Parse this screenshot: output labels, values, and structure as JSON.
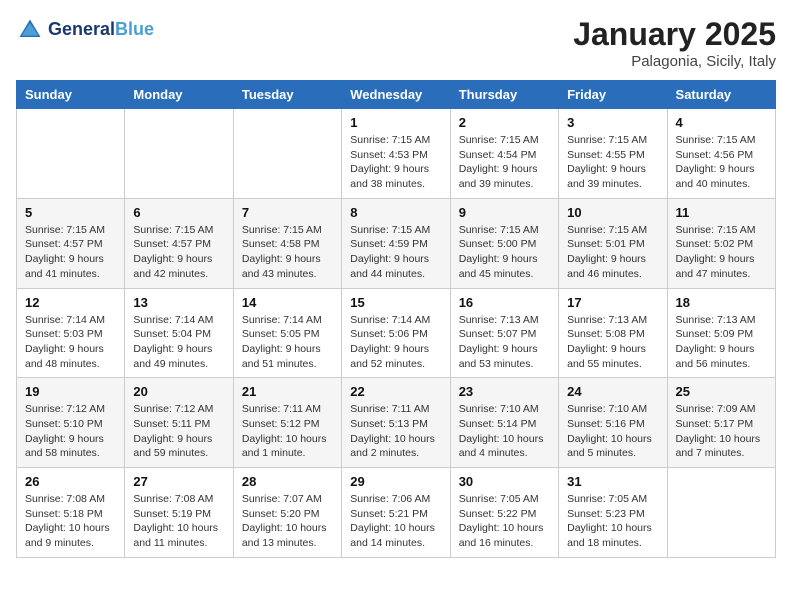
{
  "header": {
    "logo_line1": "General",
    "logo_line2": "Blue",
    "main_title": "January 2025",
    "subtitle": "Palagonia, Sicily, Italy"
  },
  "weekdays": [
    "Sunday",
    "Monday",
    "Tuesday",
    "Wednesday",
    "Thursday",
    "Friday",
    "Saturday"
  ],
  "weeks": [
    [
      {
        "day": "",
        "info": ""
      },
      {
        "day": "",
        "info": ""
      },
      {
        "day": "",
        "info": ""
      },
      {
        "day": "1",
        "info": "Sunrise: 7:15 AM\nSunset: 4:53 PM\nDaylight: 9 hours\nand 38 minutes."
      },
      {
        "day": "2",
        "info": "Sunrise: 7:15 AM\nSunset: 4:54 PM\nDaylight: 9 hours\nand 39 minutes."
      },
      {
        "day": "3",
        "info": "Sunrise: 7:15 AM\nSunset: 4:55 PM\nDaylight: 9 hours\nand 39 minutes."
      },
      {
        "day": "4",
        "info": "Sunrise: 7:15 AM\nSunset: 4:56 PM\nDaylight: 9 hours\nand 40 minutes."
      }
    ],
    [
      {
        "day": "5",
        "info": "Sunrise: 7:15 AM\nSunset: 4:57 PM\nDaylight: 9 hours\nand 41 minutes."
      },
      {
        "day": "6",
        "info": "Sunrise: 7:15 AM\nSunset: 4:57 PM\nDaylight: 9 hours\nand 42 minutes."
      },
      {
        "day": "7",
        "info": "Sunrise: 7:15 AM\nSunset: 4:58 PM\nDaylight: 9 hours\nand 43 minutes."
      },
      {
        "day": "8",
        "info": "Sunrise: 7:15 AM\nSunset: 4:59 PM\nDaylight: 9 hours\nand 44 minutes."
      },
      {
        "day": "9",
        "info": "Sunrise: 7:15 AM\nSunset: 5:00 PM\nDaylight: 9 hours\nand 45 minutes."
      },
      {
        "day": "10",
        "info": "Sunrise: 7:15 AM\nSunset: 5:01 PM\nDaylight: 9 hours\nand 46 minutes."
      },
      {
        "day": "11",
        "info": "Sunrise: 7:15 AM\nSunset: 5:02 PM\nDaylight: 9 hours\nand 47 minutes."
      }
    ],
    [
      {
        "day": "12",
        "info": "Sunrise: 7:14 AM\nSunset: 5:03 PM\nDaylight: 9 hours\nand 48 minutes."
      },
      {
        "day": "13",
        "info": "Sunrise: 7:14 AM\nSunset: 5:04 PM\nDaylight: 9 hours\nand 49 minutes."
      },
      {
        "day": "14",
        "info": "Sunrise: 7:14 AM\nSunset: 5:05 PM\nDaylight: 9 hours\nand 51 minutes."
      },
      {
        "day": "15",
        "info": "Sunrise: 7:14 AM\nSunset: 5:06 PM\nDaylight: 9 hours\nand 52 minutes."
      },
      {
        "day": "16",
        "info": "Sunrise: 7:13 AM\nSunset: 5:07 PM\nDaylight: 9 hours\nand 53 minutes."
      },
      {
        "day": "17",
        "info": "Sunrise: 7:13 AM\nSunset: 5:08 PM\nDaylight: 9 hours\nand 55 minutes."
      },
      {
        "day": "18",
        "info": "Sunrise: 7:13 AM\nSunset: 5:09 PM\nDaylight: 9 hours\nand 56 minutes."
      }
    ],
    [
      {
        "day": "19",
        "info": "Sunrise: 7:12 AM\nSunset: 5:10 PM\nDaylight: 9 hours\nand 58 minutes."
      },
      {
        "day": "20",
        "info": "Sunrise: 7:12 AM\nSunset: 5:11 PM\nDaylight: 9 hours\nand 59 minutes."
      },
      {
        "day": "21",
        "info": "Sunrise: 7:11 AM\nSunset: 5:12 PM\nDaylight: 10 hours\nand 1 minute."
      },
      {
        "day": "22",
        "info": "Sunrise: 7:11 AM\nSunset: 5:13 PM\nDaylight: 10 hours\nand 2 minutes."
      },
      {
        "day": "23",
        "info": "Sunrise: 7:10 AM\nSunset: 5:14 PM\nDaylight: 10 hours\nand 4 minutes."
      },
      {
        "day": "24",
        "info": "Sunrise: 7:10 AM\nSunset: 5:16 PM\nDaylight: 10 hours\nand 5 minutes."
      },
      {
        "day": "25",
        "info": "Sunrise: 7:09 AM\nSunset: 5:17 PM\nDaylight: 10 hours\nand 7 minutes."
      }
    ],
    [
      {
        "day": "26",
        "info": "Sunrise: 7:08 AM\nSunset: 5:18 PM\nDaylight: 10 hours\nand 9 minutes."
      },
      {
        "day": "27",
        "info": "Sunrise: 7:08 AM\nSunset: 5:19 PM\nDaylight: 10 hours\nand 11 minutes."
      },
      {
        "day": "28",
        "info": "Sunrise: 7:07 AM\nSunset: 5:20 PM\nDaylight: 10 hours\nand 13 minutes."
      },
      {
        "day": "29",
        "info": "Sunrise: 7:06 AM\nSunset: 5:21 PM\nDaylight: 10 hours\nand 14 minutes."
      },
      {
        "day": "30",
        "info": "Sunrise: 7:05 AM\nSunset: 5:22 PM\nDaylight: 10 hours\nand 16 minutes."
      },
      {
        "day": "31",
        "info": "Sunrise: 7:05 AM\nSunset: 5:23 PM\nDaylight: 10 hours\nand 18 minutes."
      },
      {
        "day": "",
        "info": ""
      }
    ]
  ]
}
